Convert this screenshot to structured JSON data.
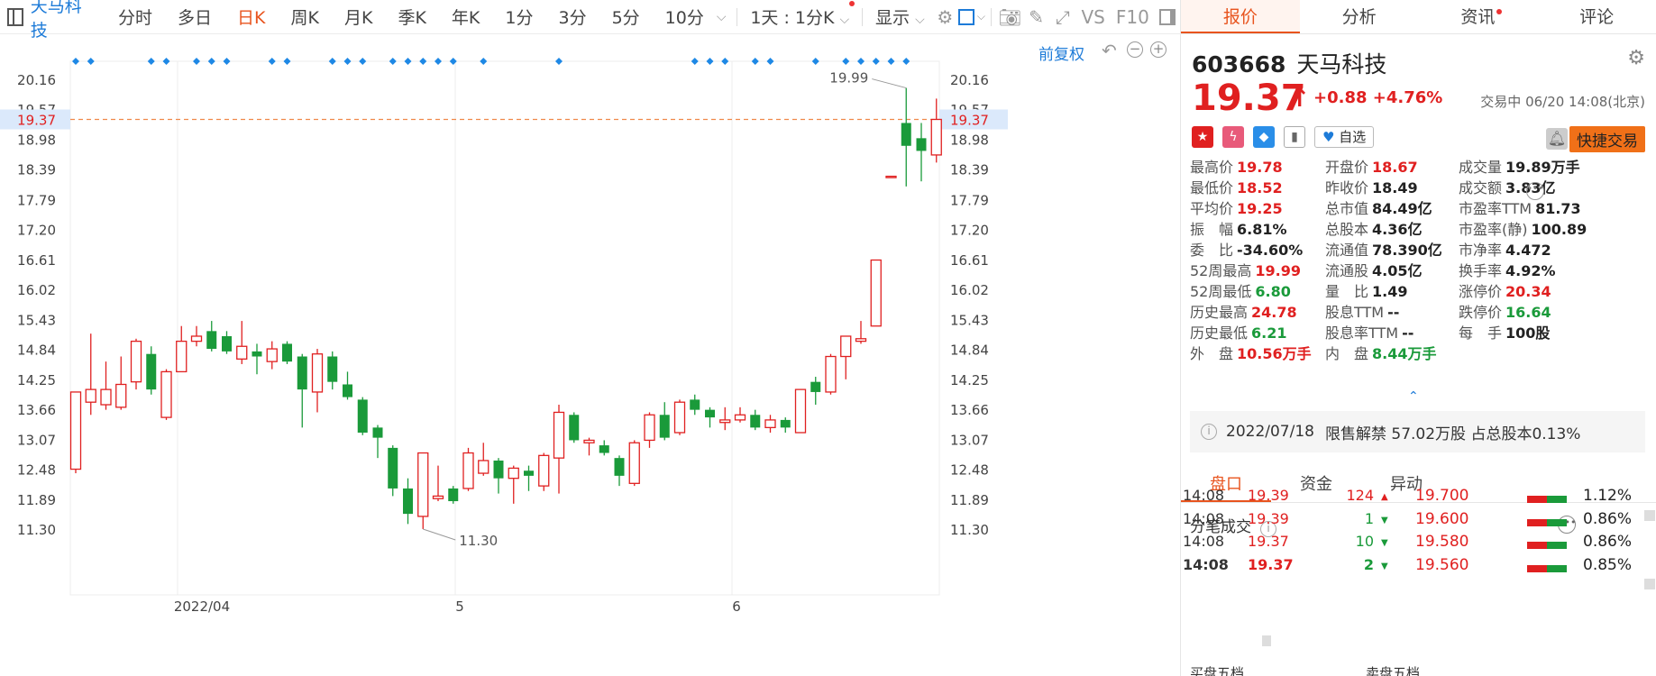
{
  "toolbar": {
    "stock_name": "天马科技",
    "periods": [
      "分时",
      "多日",
      "日K",
      "周K",
      "月K",
      "季K",
      "年K",
      "1分",
      "3分",
      "5分",
      "10分"
    ],
    "active_period": "日K",
    "interval_select": "1天 : 1分K",
    "display_label": "显示",
    "vs_label": "VS",
    "f10_label": "F10",
    "icons": [
      "panel-icon",
      "gear-icon",
      "checkbox-icon",
      "camera-icon",
      "pencil-icon",
      "fullscreen-icon",
      "sidebar-icon"
    ]
  },
  "chart": {
    "adjust_label": "前复权",
    "current_price_label": "19.37",
    "high_marker": "19.99",
    "low_marker": "11.30",
    "month_labels": [
      "2022/04",
      "5",
      "6"
    ]
  },
  "chart_data": {
    "type": "candlestick",
    "y_ticks": [
      "20.16",
      "19.57",
      "18.98",
      "18.39",
      "17.79",
      "17.20",
      "16.61",
      "16.02",
      "15.43",
      "14.84",
      "14.25",
      "13.66",
      "13.07",
      "12.48",
      "11.89",
      "11.30"
    ],
    "ylim": [
      10.9,
      20.6
    ],
    "current_price": 19.37,
    "candles": [
      {
        "o": 12.48,
        "c": 14.0,
        "h": 14.0,
        "l": 12.4
      },
      {
        "o": 13.8,
        "c": 14.05,
        "h": 15.15,
        "l": 13.55
      },
      {
        "o": 13.75,
        "c": 14.05,
        "h": 14.6,
        "l": 13.65
      },
      {
        "o": 13.7,
        "c": 14.15,
        "h": 14.7,
        "l": 13.65
      },
      {
        "o": 14.2,
        "c": 15.0,
        "h": 15.05,
        "l": 14.05
      },
      {
        "o": 14.75,
        "c": 14.05,
        "h": 14.9,
        "l": 13.95
      },
      {
        "o": 13.5,
        "c": 14.4,
        "h": 14.45,
        "l": 13.45
      },
      {
        "o": 14.4,
        "c": 15.0,
        "h": 15.3,
        "l": 14.4
      },
      {
        "o": 15.0,
        "c": 15.1,
        "h": 15.3,
        "l": 14.9
      },
      {
        "o": 15.2,
        "c": 14.85,
        "h": 15.4,
        "l": 14.8
      },
      {
        "o": 15.1,
        "c": 14.8,
        "h": 15.2,
        "l": 14.75
      },
      {
        "o": 14.65,
        "c": 14.9,
        "h": 15.4,
        "l": 14.55
      },
      {
        "o": 14.8,
        "c": 14.7,
        "h": 14.95,
        "l": 14.35
      },
      {
        "o": 14.6,
        "c": 14.85,
        "h": 15.0,
        "l": 14.45
      },
      {
        "o": 14.95,
        "c": 14.6,
        "h": 15.0,
        "l": 14.55
      },
      {
        "o": 14.7,
        "c": 14.05,
        "h": 14.75,
        "l": 13.3
      },
      {
        "o": 14.0,
        "c": 14.75,
        "h": 14.85,
        "l": 13.6
      },
      {
        "o": 14.7,
        "c": 14.2,
        "h": 14.8,
        "l": 14.05
      },
      {
        "o": 14.15,
        "c": 13.9,
        "h": 14.4,
        "l": 13.85
      },
      {
        "o": 13.85,
        "c": 13.2,
        "h": 13.9,
        "l": 13.15
      },
      {
        "o": 13.3,
        "c": 13.1,
        "h": 13.35,
        "l": 12.7
      },
      {
        "o": 12.9,
        "c": 12.1,
        "h": 12.95,
        "l": 11.95
      },
      {
        "o": 12.1,
        "c": 11.6,
        "h": 12.3,
        "l": 11.4
      },
      {
        "o": 11.55,
        "c": 12.8,
        "h": 12.8,
        "l": 11.3
      },
      {
        "o": 11.9,
        "c": 11.95,
        "h": 12.55,
        "l": 11.85
      },
      {
        "o": 12.1,
        "c": 11.85,
        "h": 12.15,
        "l": 11.8
      },
      {
        "o": 12.1,
        "c": 12.8,
        "h": 12.9,
        "l": 12.05
      },
      {
        "o": 12.4,
        "c": 12.65,
        "h": 13.0,
        "l": 12.35
      },
      {
        "o": 12.65,
        "c": 12.3,
        "h": 12.7,
        "l": 12.0
      },
      {
        "o": 12.3,
        "c": 12.5,
        "h": 12.55,
        "l": 11.8
      },
      {
        "o": 12.45,
        "c": 12.35,
        "h": 12.55,
        "l": 12.05
      },
      {
        "o": 12.15,
        "c": 12.75,
        "h": 12.8,
        "l": 12.05
      },
      {
        "o": 12.7,
        "c": 13.6,
        "h": 13.75,
        "l": 12.0
      },
      {
        "o": 13.55,
        "c": 13.05,
        "h": 13.6,
        "l": 13.0
      },
      {
        "o": 13.0,
        "c": 13.05,
        "h": 13.1,
        "l": 12.75
      },
      {
        "o": 12.95,
        "c": 12.8,
        "h": 13.05,
        "l": 12.75
      },
      {
        "o": 12.7,
        "c": 12.35,
        "h": 12.75,
        "l": 12.15
      },
      {
        "o": 12.2,
        "c": 13.0,
        "h": 13.05,
        "l": 12.15
      },
      {
        "o": 13.05,
        "c": 13.55,
        "h": 13.6,
        "l": 12.9
      },
      {
        "o": 13.55,
        "c": 13.1,
        "h": 13.8,
        "l": 13.05
      },
      {
        "o": 13.2,
        "c": 13.8,
        "h": 13.85,
        "l": 13.15
      },
      {
        "o": 13.85,
        "c": 13.65,
        "h": 13.95,
        "l": 13.55
      },
      {
        "o": 13.65,
        "c": 13.5,
        "h": 13.7,
        "l": 13.3
      },
      {
        "o": 13.4,
        "c": 13.45,
        "h": 13.7,
        "l": 13.25
      },
      {
        "o": 13.45,
        "c": 13.55,
        "h": 13.7,
        "l": 13.4
      },
      {
        "o": 13.55,
        "c": 13.3,
        "h": 13.65,
        "l": 13.25
      },
      {
        "o": 13.3,
        "c": 13.45,
        "h": 13.55,
        "l": 13.2
      },
      {
        "o": 13.45,
        "c": 13.3,
        "h": 13.5,
        "l": 13.2
      },
      {
        "o": 13.2,
        "c": 14.05,
        "h": 14.05,
        "l": 13.2
      },
      {
        "o": 14.2,
        "c": 14.0,
        "h": 14.3,
        "l": 13.75
      },
      {
        "o": 14.0,
        "c": 14.7,
        "h": 14.75,
        "l": 13.95
      },
      {
        "o": 14.7,
        "c": 15.1,
        "h": 15.1,
        "l": 14.25
      },
      {
        "o": 15.0,
        "c": 15.05,
        "h": 15.4,
        "l": 14.95
      },
      {
        "o": 15.3,
        "c": 16.6,
        "h": 16.6,
        "l": 15.3
      },
      {
        "o": 18.25,
        "c": 18.25,
        "h": 18.25,
        "l": 18.25
      },
      {
        "o": 19.3,
        "c": 18.85,
        "h": 19.99,
        "l": 18.05
      },
      {
        "o": 19.0,
        "c": 18.75,
        "h": 19.3,
        "l": 18.15
      },
      {
        "o": 18.67,
        "c": 19.37,
        "h": 19.78,
        "l": 18.52
      }
    ],
    "marker_candles": [
      0,
      1,
      5,
      6,
      8,
      9,
      10,
      13,
      14,
      17,
      18,
      19,
      21,
      22,
      23,
      24,
      25,
      27,
      32,
      41,
      42,
      43,
      45,
      46,
      49,
      51,
      52,
      53,
      54,
      55
    ]
  },
  "quote": {
    "tabs": [
      "报价",
      "分析",
      "资讯",
      "评论"
    ],
    "active_tab": "报价",
    "code": "603668",
    "name": "天马科技",
    "price": "19.37",
    "change": "+0.88",
    "change_pct": "+4.76%",
    "status": "交易中 06/20 14:08(北京)",
    "watch_label": "自选",
    "trade_label": "快捷交易"
  },
  "stats": [
    {
      "label": "最高价",
      "value": "19.78",
      "tone": "up"
    },
    {
      "label": "开盘价",
      "value": "18.67",
      "tone": "up"
    },
    {
      "label": "成交量",
      "value": "19.89万手",
      "tone": "nt"
    },
    {
      "label": "最低价",
      "value": "18.52",
      "tone": "up"
    },
    {
      "label": "昨收价",
      "value": "18.49",
      "tone": "nt"
    },
    {
      "label": "成交额",
      "value": "3.83亿",
      "tone": "nt"
    },
    {
      "label": "平均价",
      "value": "19.25",
      "tone": "up"
    },
    {
      "label": "总市值",
      "value": "84.49亿",
      "tone": "nt"
    },
    {
      "label": "市盈率TTM",
      "value": "81.73",
      "tone": "nt"
    },
    {
      "label": "振　幅",
      "value": "6.81%",
      "tone": "nt"
    },
    {
      "label": "总股本",
      "value": "4.36亿",
      "tone": "nt"
    },
    {
      "label": "市盈率(静)",
      "value": "100.89",
      "tone": "nt"
    },
    {
      "label": "委　比",
      "value": "-34.60%",
      "tone": "nt"
    },
    {
      "label": "流通值",
      "value": "78.390亿",
      "tone": "nt"
    },
    {
      "label": "市净率",
      "value": "4.472",
      "tone": "nt"
    },
    {
      "label": "52周最高",
      "value": "19.99",
      "tone": "up"
    },
    {
      "label": "流通股",
      "value": "4.05亿",
      "tone": "nt"
    },
    {
      "label": "换手率",
      "value": "4.92%",
      "tone": "nt"
    },
    {
      "label": "52周最低",
      "value": "6.80",
      "tone": "dn"
    },
    {
      "label": "量　比",
      "value": "1.49",
      "tone": "nt"
    },
    {
      "label": "涨停价",
      "value": "20.34",
      "tone": "up"
    },
    {
      "label": "历史最高",
      "value": "24.78",
      "tone": "up"
    },
    {
      "label": "股息TTM",
      "value": "--",
      "tone": "nt"
    },
    {
      "label": "跌停价",
      "value": "16.64",
      "tone": "dn"
    },
    {
      "label": "历史最低",
      "value": "6.21",
      "tone": "dn"
    },
    {
      "label": "股息率TTM",
      "value": "--",
      "tone": "nt"
    },
    {
      "label": "每　手",
      "value": "100股",
      "tone": "nt"
    },
    {
      "label": "外　盘",
      "value": "10.56万手",
      "tone": "up"
    },
    {
      "label": "内　盘",
      "value": "8.44万手",
      "tone": "dn"
    }
  ],
  "notice": {
    "date": "2022/07/18",
    "text": "限售解禁 57.02万股 占总股本0.13%"
  },
  "subtabs": [
    "盘口",
    "资金",
    "异动"
  ],
  "active_subtab": "盘口",
  "ticks_title": "分笔成交",
  "ticks": [
    {
      "time": "14:08",
      "price": "19.39",
      "vol": "124",
      "dir": "up"
    },
    {
      "time": "14:08",
      "price": "19.39",
      "vol": "1",
      "dir": "dn"
    },
    {
      "time": "14:08",
      "price": "19.37",
      "vol": "10",
      "dir": "dn"
    },
    {
      "time": "14:08",
      "price": "19.37",
      "vol": "2",
      "dir": "dn"
    }
  ],
  "depth": [
    {
      "price": "19.700",
      "pct": "1.12%"
    },
    {
      "price": "19.600",
      "pct": "0.86%"
    },
    {
      "price": "19.580",
      "pct": "0.86%"
    },
    {
      "price": "19.560",
      "pct": "0.85%"
    }
  ],
  "footer": {
    "buy_label": "买盘五档",
    "sell_label": "卖盘五档"
  },
  "colors": {
    "up": "#e02020",
    "down": "#1a9a3a",
    "accent": "#e8541e",
    "link": "#1d7bd8",
    "marker": "#1e88e5"
  }
}
